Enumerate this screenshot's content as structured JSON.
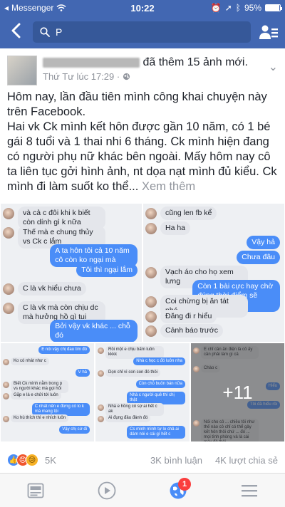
{
  "status": {
    "carrier": "Messenger",
    "time": "10:22",
    "battery": "95%",
    "battery_level": 0.95
  },
  "nav": {
    "search_text": "P"
  },
  "post": {
    "author_action": "đã thêm 15 ảnh mới.",
    "timestamp": "Thứ Tư lúc 17:29 ·",
    "paragraph1": "Hôm nay, lần đầu tiên mình công khai chuyện này trên Facebook.",
    "paragraph2": "Hai vk Ck mình kết hôn được gần 10 năm, có 1 bé gái 8 tuổi và 1 thai nhi 6 tháng. Ck mình hiện đang có người phụ nữ khác bên ngoài. Mấy hôm nay cô ta liên tục gởi hình ảnh, nt dọa nạt mình đủ kiểu. Ck mình đi làm suốt ko thể...",
    "see_more": "Xem thêm"
  },
  "photos": {
    "chat1": [
      {
        "side": "in",
        "text": "và cả c đôi khi k biết còn dính gì k nữa"
      },
      {
        "side": "in",
        "text": "Thế mà e chung thủy vs Ck c lắm"
      },
      {
        "side": "out",
        "text": "A ta hôn tôi cả 10 năm cô còn ko ngại mà"
      },
      {
        "side": "out",
        "text": "Tôi thì ngại lắm"
      },
      {
        "side": "in",
        "text": "C là vk hiểu chưa"
      },
      {
        "side": "in",
        "text": "C là vk mà còn chịu dc mà hưởng hồ gì tui"
      },
      {
        "side": "out",
        "text": "Bởi vậy vk khác ... chỗ đó"
      }
    ],
    "chat2": [
      {
        "side": "in",
        "text": "cũng len fb kể"
      },
      {
        "side": "in",
        "text": "Ha ha"
      },
      {
        "side": "out",
        "text": "Vậy hả"
      },
      {
        "side": "out",
        "text": "Chưa đâu"
      },
      {
        "side": "in",
        "text": "Vạch áo cho họ xem lưng"
      },
      {
        "side": "out",
        "text": "Còn 1 bài cực hay chờ đúng thời điểm sẽ đăng"
      },
      {
        "side": "in",
        "text": "Coi chừng bị ăn tát nhé"
      },
      {
        "side": "in",
        "text": "Đăng đi r hiểu"
      },
      {
        "side": "in",
        "text": "Cảnh báo trước"
      }
    ],
    "chat3": [
      {
        "side": "out",
        "text": "E nói vậy chị đau tim đó"
      },
      {
        "side": "in",
        "text": "Ko có nhát như c"
      },
      {
        "side": "out",
        "text": "V hả"
      },
      {
        "side": "in",
        "text": "Biết Ck mình nằm trong p vs người khác mà gọi hỏi"
      },
      {
        "side": "in",
        "text": "Gặp e là e chửi tới luôn"
      },
      {
        "side": "out",
        "text": "C nhát nên e đừng có lo k mà mang tội"
      },
      {
        "side": "in",
        "text": "Ko hù thích thì e nhích luôn"
      },
      {
        "side": "out",
        "text": "Vậy chị cứ đi"
      }
    ],
    "chat4": [
      {
        "side": "in",
        "text": "Rồi một e chịu bấm luôn kkkk"
      },
      {
        "side": "out",
        "text": "Nhà c học c đó luôn nha"
      },
      {
        "side": "in",
        "text": "Dọn chỉ vì con con đó thôi"
      },
      {
        "side": "out",
        "text": "Còn chỗ buôn bán nữa"
      },
      {
        "side": "out",
        "text": "Nhà c người quê thì chị thật"
      },
      {
        "side": "in",
        "text": "Nhà e hồng có sợ ai hết c ak"
      },
      {
        "side": "in",
        "text": "Ai đụng đâu đánh đó"
      },
      {
        "side": "out",
        "text": "Cs mình mình tự lo chả ai dám nói e cái gì hết c"
      }
    ],
    "chat5": [
      {
        "side": "in",
        "text": "E chỉ cần ăn điện là cô ấy cần phải làm gì cả"
      },
      {
        "side": "in",
        "text": "Chào c"
      },
      {
        "side": "out",
        "text": "Hiểu"
      },
      {
        "side": "out",
        "text": "Tôi đã hiểu rồi"
      },
      {
        "side": "in",
        "text": "Nói cho cô ... chiều tôi như thế nào cô chỉ có thể gây kết hôn thôi chứ ... đó ... mọi tình phòng và là cái máy đẻ thôi"
      }
    ],
    "more_count": "+11"
  },
  "footer": {
    "reaction_count": "5K",
    "comments": "3K bình luận",
    "shares": "4K lượt chia sẻ"
  },
  "tabbar": {
    "badge": "1"
  },
  "colors": {
    "facebook_blue": "#4267b2",
    "messenger_blue": "#4a8df8",
    "badge_red": "#fa3e3e"
  }
}
